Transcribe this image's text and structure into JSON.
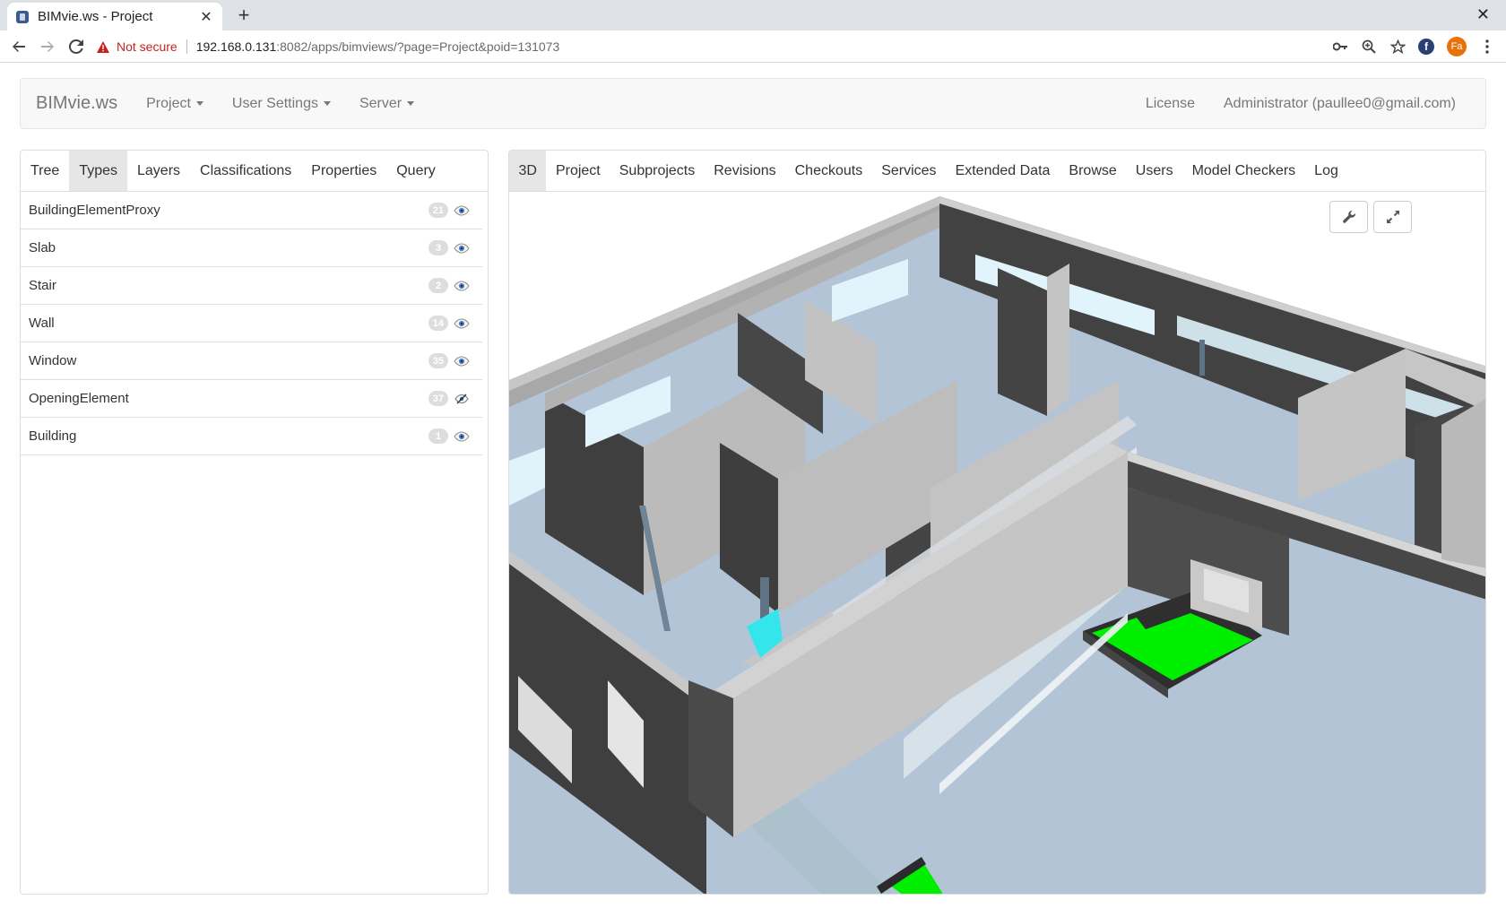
{
  "browser": {
    "tab_title": "BIMvie.ws - Project",
    "tab_close": "✕",
    "new_tab": "+",
    "window_close": "✕",
    "not_secure": "Not secure",
    "url_host": "192.168.0.131",
    "url_rest": ":8082/apps/bimviews/?page=Project&poid=131073",
    "profile_initials": "Fa",
    "fedora_letter": "f"
  },
  "navbar": {
    "brand": "BIMvie.ws",
    "items": [
      "Project",
      "User Settings",
      "Server"
    ],
    "right": [
      "License",
      "Administrator (paullee0@gmail.com)"
    ]
  },
  "left_tabs": [
    {
      "label": "Tree",
      "active": false
    },
    {
      "label": "Types",
      "active": true
    },
    {
      "label": "Layers",
      "active": false
    },
    {
      "label": "Classifications",
      "active": false
    },
    {
      "label": "Properties",
      "active": false
    },
    {
      "label": "Query",
      "active": false
    }
  ],
  "types": [
    {
      "name": "BuildingElementProxy",
      "count": "21",
      "icon": "eye-icon"
    },
    {
      "name": "Slab",
      "count": "3",
      "icon": "eye-icon"
    },
    {
      "name": "Stair",
      "count": "2",
      "icon": "eye-icon"
    },
    {
      "name": "Wall",
      "count": "14",
      "icon": "eye-icon"
    },
    {
      "name": "Window",
      "count": "35",
      "icon": "eye-icon"
    },
    {
      "name": "OpeningElement",
      "count": "37",
      "icon": "eye-slash-icon"
    },
    {
      "name": "Building",
      "count": "1",
      "icon": "eye-icon"
    }
  ],
  "right_tabs": [
    {
      "label": "3D",
      "active": true
    },
    {
      "label": "Project",
      "active": false
    },
    {
      "label": "Subprojects",
      "active": false
    },
    {
      "label": "Revisions",
      "active": false
    },
    {
      "label": "Checkouts",
      "active": false
    },
    {
      "label": "Services",
      "active": false
    },
    {
      "label": "Extended Data",
      "active": false
    },
    {
      "label": "Browse",
      "active": false
    },
    {
      "label": "Users",
      "active": false
    },
    {
      "label": "Model Checkers",
      "active": false
    },
    {
      "label": "Log",
      "active": false
    }
  ],
  "viewer": {
    "settings_icon": "wrench-icon",
    "fullscreen_icon": "expand-icon"
  },
  "colors": {
    "floor": "#b3c4d6",
    "wall_light": "#c0c0c0",
    "wall_dark": "#424242",
    "highlight_green": "#00ee00",
    "window_glass": "#e2f4fb",
    "cyan": "#33e6ec"
  }
}
